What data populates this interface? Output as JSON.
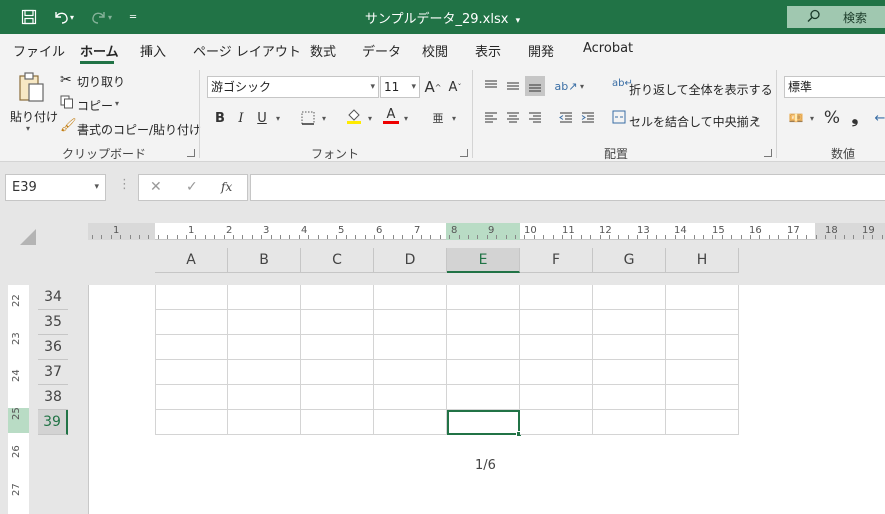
{
  "titlebar": {
    "filename": "サンプルデータ_29.xlsx",
    "title_caret": "▾",
    "search_placeholder": "検索",
    "icons": [
      "save-icon",
      "undo-icon",
      "redo-icon",
      "customize-qat-icon",
      "search-icon"
    ]
  },
  "tabs": [
    "ファイル",
    "ホーム",
    "挿入",
    "ページ レイアウト",
    "数式",
    "データ",
    "校閲",
    "表示",
    "開発",
    "Acrobat"
  ],
  "active_tab": "ホーム",
  "ribbon": {
    "clipboard": {
      "paste": "貼り付け",
      "cut": "切り取り",
      "copy": "コピー",
      "format_painter": "書式のコピー/貼り付け",
      "label": "クリップボード"
    },
    "font": {
      "font_name": "游ゴシック",
      "font_size": "11",
      "bold": "B",
      "italic": "I",
      "underline": "U",
      "grow": "A",
      "shrink": "A",
      "font_color": "A",
      "label": "フォント"
    },
    "alignment": {
      "wrap_text": "折り返して全体を表示する",
      "merge_center": "セルを結合して中央揃え",
      "label": "配置"
    },
    "number": {
      "format": "標準",
      "percent": "%",
      "comma": "❟",
      "label": "数値"
    }
  },
  "formula_bar": {
    "name_box": "E39",
    "cancel": "✕",
    "enter": "✓",
    "fx": "fx",
    "formula": ""
  },
  "columns": [
    "A",
    "B",
    "C",
    "D",
    "E",
    "F",
    "G",
    "H"
  ],
  "selected_column": "E",
  "rows": [
    "34",
    "35",
    "36",
    "37",
    "38",
    "39"
  ],
  "selected_row": "39",
  "ruler_numbers": [
    "1",
    "1",
    "2",
    "3",
    "4",
    "5",
    "6",
    "7",
    "8",
    "9",
    "10",
    "11",
    "12",
    "13",
    "14",
    "15",
    "16",
    "17",
    "18",
    "19"
  ],
  "vruler_numbers": [
    "22",
    "23",
    "24",
    "25",
    "26",
    "27"
  ],
  "page_indicator": "1/6",
  "colors": {
    "accent": "#217346"
  }
}
